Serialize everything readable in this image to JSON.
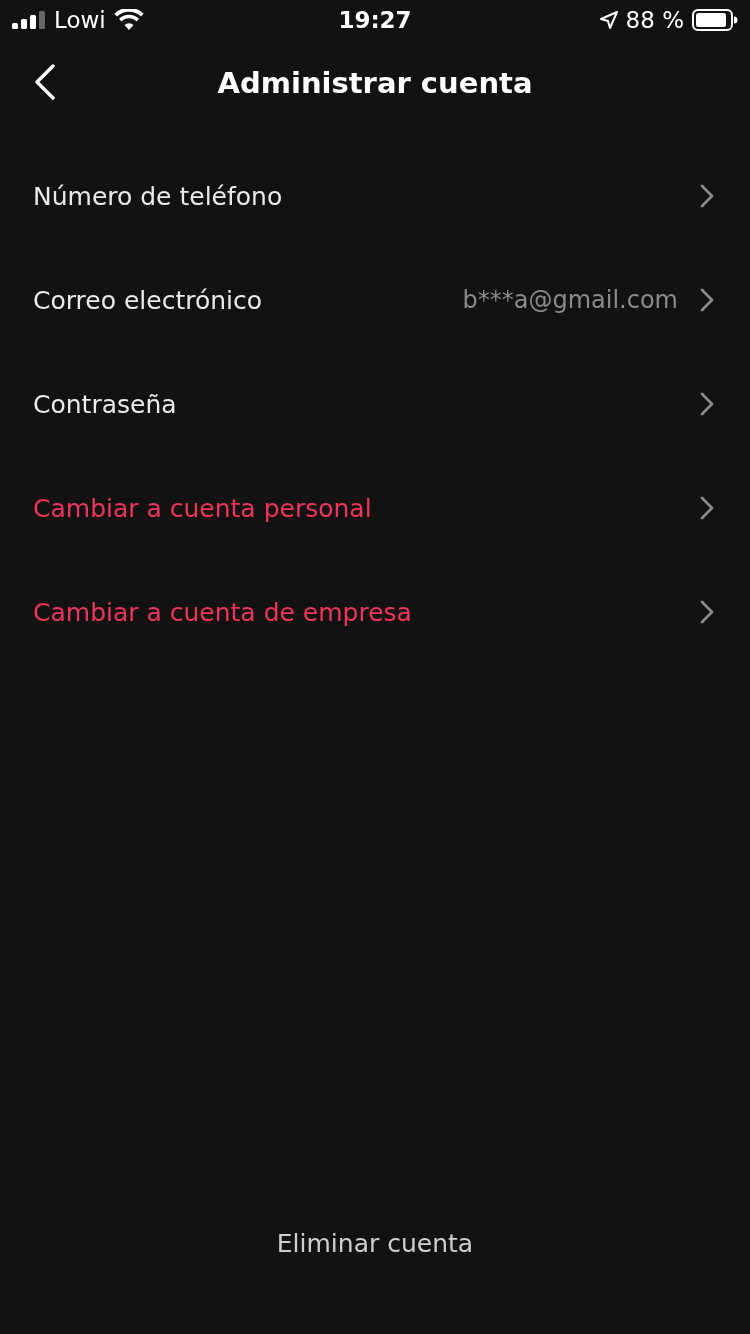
{
  "status_bar": {
    "carrier": "Lowi",
    "time": "19:27",
    "battery": "88 %"
  },
  "header": {
    "title": "Administrar cuenta"
  },
  "rows": [
    {
      "label": "Número de teléfono",
      "kind": "default"
    },
    {
      "label": "Correo electrónico",
      "value": "b***a@gmail.com",
      "kind": "default"
    },
    {
      "label": "Contraseña",
      "kind": "default"
    },
    {
      "label": "Cambiar a cuenta personal",
      "kind": "accent"
    },
    {
      "label": "Cambiar a cuenta de empresa",
      "kind": "accent"
    }
  ],
  "footer": {
    "delete_label": "Eliminar cuenta"
  }
}
